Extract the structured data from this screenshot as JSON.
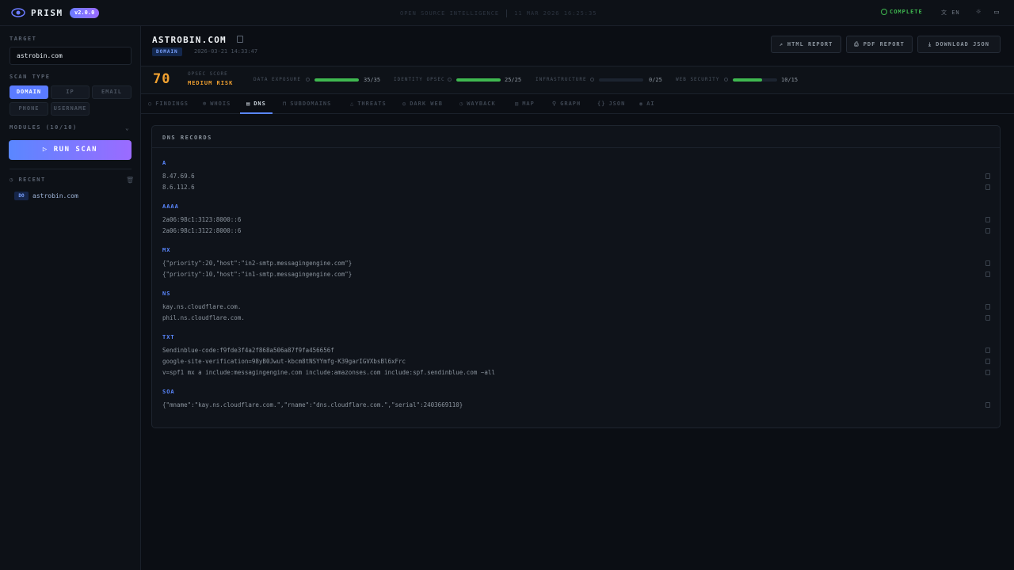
{
  "app": {
    "name": "PRISM",
    "version": "v2.0.0",
    "center_title": "OPEN SOURCE INTELLIGENCE",
    "center_date": "11 MAR 2026 16:25:35",
    "status": "COMPLETE",
    "language": "EN"
  },
  "sidebar": {
    "target_label": "TARGET",
    "target_value": "astrobin.com",
    "scan_type_label": "SCAN TYPE",
    "scan_types": [
      "DOMAIN",
      "IP",
      "EMAIL",
      "PHONE",
      "USERNAME"
    ],
    "active_scan_type": "DOMAIN",
    "modules_label": "MODULES (10/10)",
    "run_label": "RUN SCAN",
    "recent_label": "RECENT",
    "recent": [
      {
        "badge": "DO",
        "name": "astrobin.com"
      }
    ]
  },
  "header": {
    "domain": "ASTROBIN.COM",
    "type_badge": "DOMAIN",
    "scan_date": "2026-03-21 14:33:47",
    "actions": [
      "HTML REPORT",
      "PDF REPORT",
      "DOWNLOAD JSON"
    ]
  },
  "score": {
    "value": "70",
    "label": "OPSEC SCORE",
    "risk": "MEDIUM RISK",
    "metrics": [
      {
        "label": "DATA EXPOSURE",
        "value": "35/35",
        "fraction": 1.0
      },
      {
        "label": "IDENTITY OPSEC",
        "value": "25/25",
        "fraction": 1.0
      },
      {
        "label": "INFRASTRUCTURE",
        "value": "0/25",
        "fraction": 0.0
      },
      {
        "label": "WEB SECURITY",
        "value": "10/15",
        "fraction": 0.667
      }
    ]
  },
  "tabs": [
    "FINDINGS",
    "WHOIS",
    "DNS",
    "SUBDOMAINS",
    "THREATS",
    "DARK WEB",
    "WAYBACK",
    "MAP",
    "GRAPH",
    "JSON",
    "AI"
  ],
  "active_tab": "DNS",
  "dns": {
    "title": "DNS RECORDS",
    "records": [
      {
        "type": "A",
        "values": [
          "8.47.69.6",
          "8.6.112.6"
        ]
      },
      {
        "type": "AAAA",
        "values": [
          "2a06:98c1:3123:8000::6",
          "2a06:98c1:3122:8000::6"
        ]
      },
      {
        "type": "MX",
        "values": [
          "{\"priority\":20,\"host\":\"in2-smtp.messagingengine.com\"}",
          "{\"priority\":10,\"host\":\"in1-smtp.messagingengine.com\"}"
        ]
      },
      {
        "type": "NS",
        "values": [
          "kay.ns.cloudflare.com.",
          "phil.ns.cloudflare.com."
        ]
      },
      {
        "type": "TXT",
        "values": [
          "Sendinblue-code:f9fde3f4a2f868a506a87f9fa456656f",
          "google-site-verification=98yB0Jwut-kbcm8tNSYYmfg-K39garIGVXbsBl6xFrc",
          "v=spf1 mx a include:messagingengine.com include:amazonses.com include:spf.sendinblue.com ~all"
        ]
      },
      {
        "type": "SOA",
        "values": [
          "{\"mname\":\"kay.ns.cloudflare.com.\",\"rname\":\"dns.cloudflare.com.\",\"serial\":2403669110}"
        ]
      }
    ]
  },
  "colors": {
    "accent": "#5a87ff",
    "score": "#f0a030",
    "success": "#3fb950",
    "background": "#0b0e14"
  }
}
